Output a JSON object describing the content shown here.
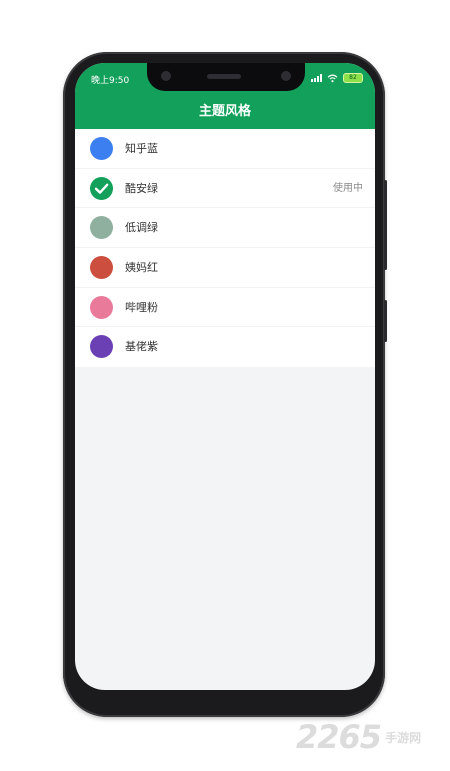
{
  "status_bar": {
    "time": "晚上9:50",
    "battery": "82"
  },
  "header": {
    "title": "主题风格"
  },
  "themes": [
    {
      "label": "知乎蓝",
      "color": "#3b7ff0",
      "selected": false,
      "status": ""
    },
    {
      "label": "酷安绿",
      "color": "#12a05a",
      "selected": true,
      "status": "使用中"
    },
    {
      "label": "低调绿",
      "color": "#8fb09e",
      "selected": false,
      "status": ""
    },
    {
      "label": "姨妈红",
      "color": "#cc4e3f",
      "selected": false,
      "status": ""
    },
    {
      "label": "哔哩粉",
      "color": "#e97a9a",
      "selected": false,
      "status": ""
    },
    {
      "label": "基佬紫",
      "color": "#6b40b5",
      "selected": false,
      "status": ""
    }
  ],
  "watermark": {
    "number": "2265",
    "site": "手游网"
  }
}
